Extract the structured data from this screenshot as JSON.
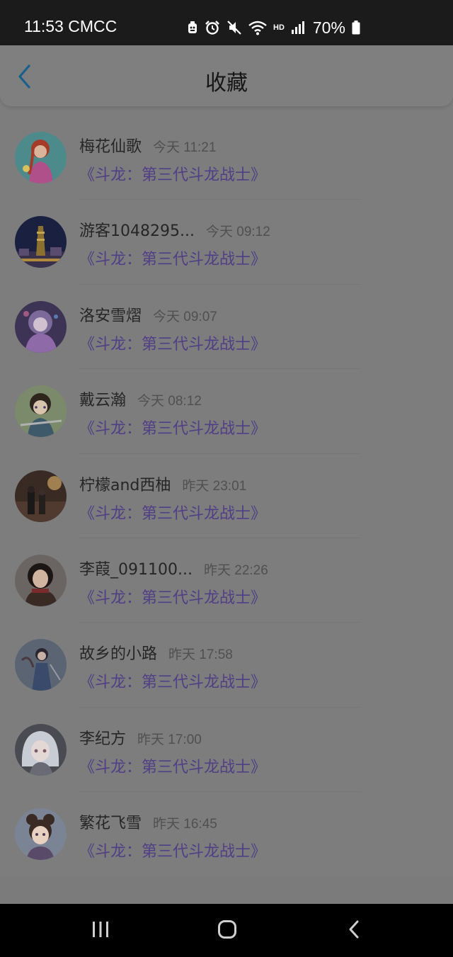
{
  "status_bar": {
    "time_carrier": "11:53 CMCC",
    "battery": "70%",
    "icons": [
      "debug-icon",
      "alarm-icon",
      "mute-icon",
      "wifi-icon",
      "hd-icon",
      "signal-icon",
      "battery-icon"
    ],
    "hd_label": "HD"
  },
  "header": {
    "title": "收藏",
    "back_icon": "chevron-left-icon",
    "accent": "#1a5f8c"
  },
  "favorites": [
    {
      "name": "梅花仙歌",
      "time": "今天 11:21",
      "book": "《斗龙：第三代斗龙战士》"
    },
    {
      "name": "游客1048295...",
      "time": "今天 09:12",
      "book": "《斗龙：第三代斗龙战士》"
    },
    {
      "name": "洛安雪熠",
      "time": "今天 09:07",
      "book": "《斗龙：第三代斗龙战士》"
    },
    {
      "name": "戴云瀚",
      "time": "今天 08:12",
      "book": "《斗龙：第三代斗龙战士》"
    },
    {
      "name": "柠檬and西柚",
      "time": "昨天 23:01",
      "book": "《斗龙：第三代斗龙战士》"
    },
    {
      "name": "李葭_091100...",
      "time": "昨天 22:26",
      "book": "《斗龙：第三代斗龙战士》"
    },
    {
      "name": "故乡的小路",
      "time": "昨天 17:58",
      "book": "《斗龙：第三代斗龙战士》"
    },
    {
      "name": "李纪方",
      "time": "昨天 17:00",
      "book": "《斗龙：第三代斗龙战士》"
    },
    {
      "name": "繁花飞雪",
      "time": "昨天 16:45",
      "book": "《斗龙：第三代斗龙战士》"
    }
  ],
  "nav_bar": {
    "icons": [
      "recent-apps-icon",
      "home-icon",
      "back-icon"
    ]
  }
}
